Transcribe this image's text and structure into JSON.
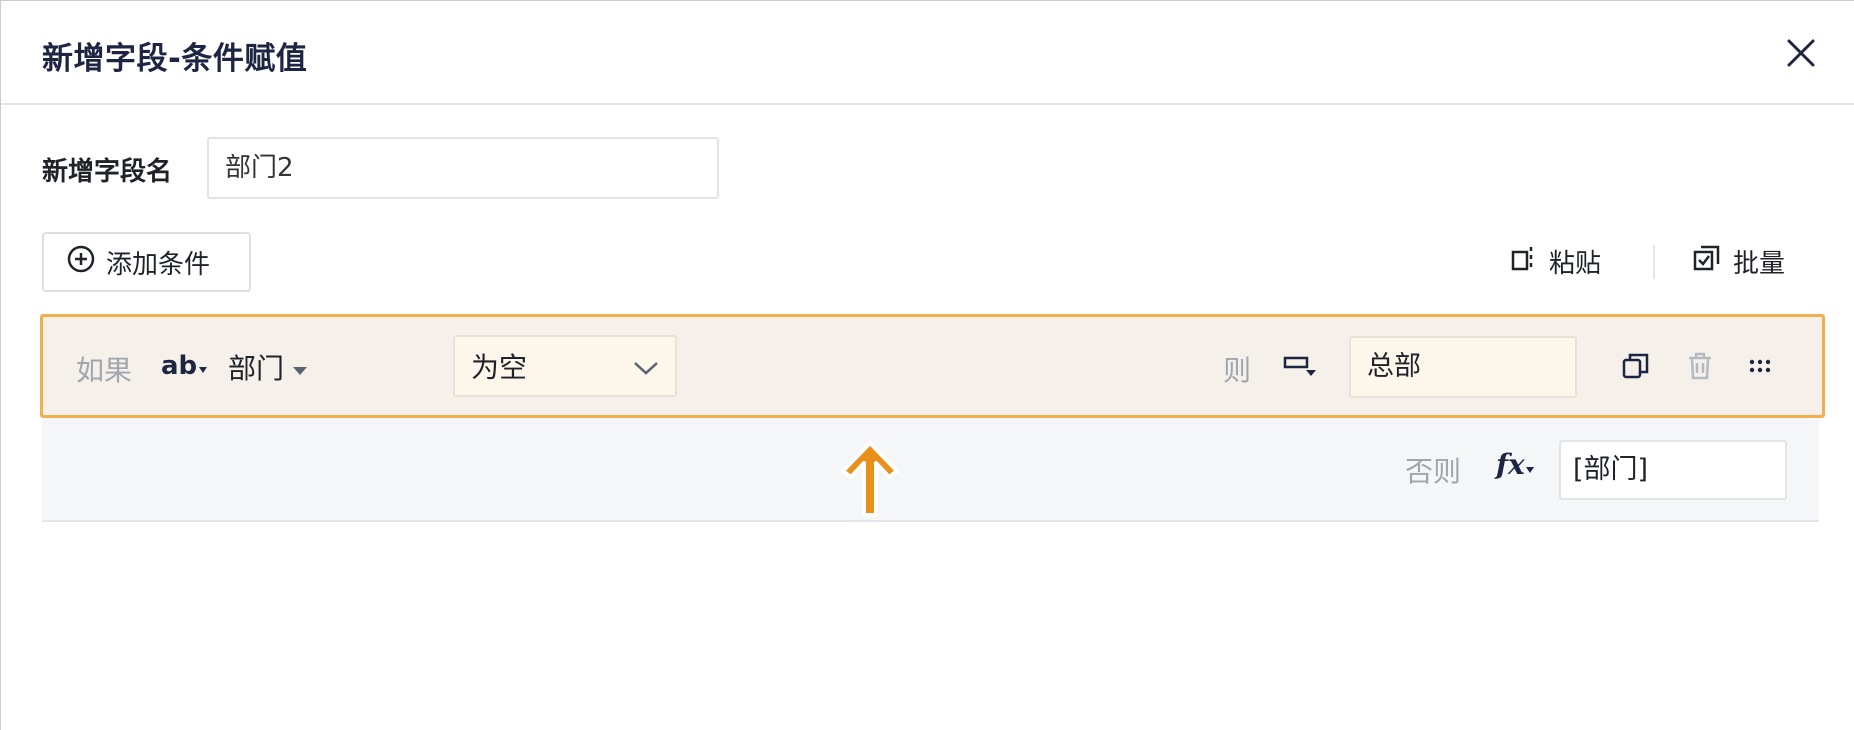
{
  "dialog": {
    "title": "新增字段-条件赋值",
    "close_icon": "close-icon"
  },
  "field_name": {
    "label": "新增字段名",
    "value": "部门2"
  },
  "toolbar": {
    "add_condition": "添加条件",
    "paste": "粘贴",
    "batch": "批量"
  },
  "condition": {
    "if_label": "如果",
    "field_type_icon": "ab",
    "field": "部门",
    "operator": "为空",
    "then_label": "则",
    "then_value": "总部"
  },
  "else": {
    "label": "否则",
    "fx_icon": "fx",
    "value": "[部门]"
  },
  "colors": {
    "accent": "#f0b04d",
    "arrow": "#e8901a",
    "title": "#1d2542"
  }
}
